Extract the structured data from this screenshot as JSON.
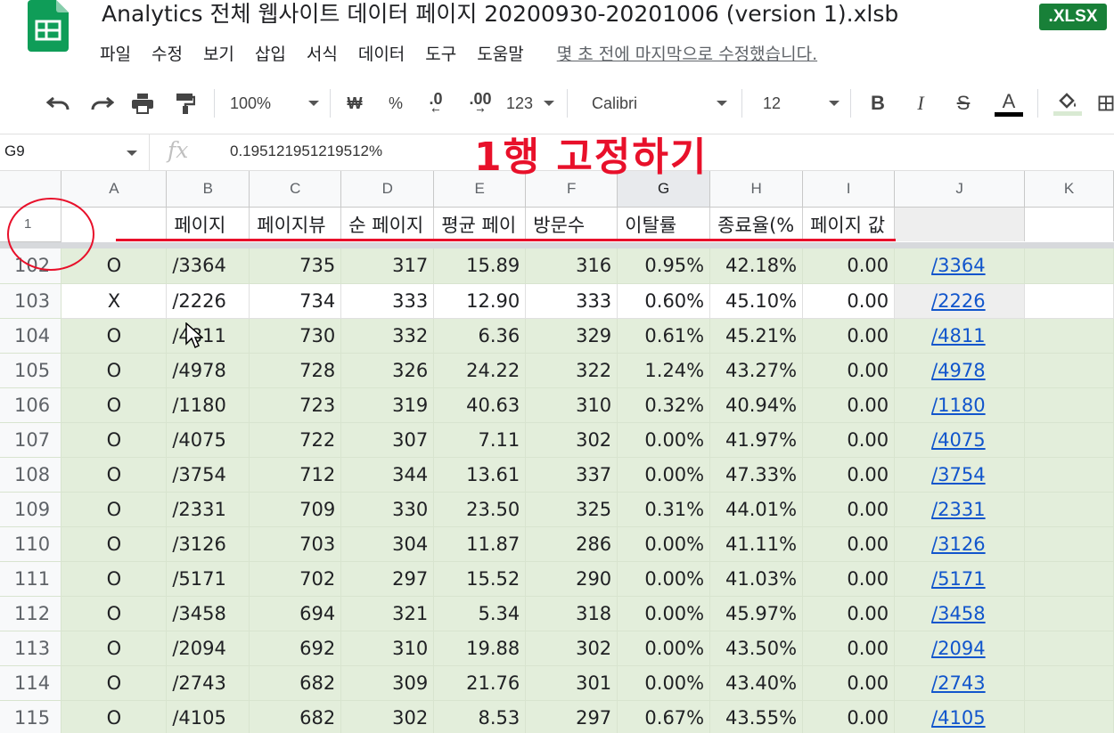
{
  "app": {
    "doc_title": "Analytics 전체 웹사이트 데이터 페이지 20200930-20201006 (version 1).xlsb",
    "file_badge": ".XLSX",
    "last_edit": "몇 초 전에 마지막으로 수정했습니다.",
    "menu": [
      "파일",
      "수정",
      "보기",
      "삽입",
      "서식",
      "데이터",
      "도구",
      "도움말"
    ],
    "brand_color": "#0f9d58",
    "badge_color": "#188038"
  },
  "toolbar": {
    "zoom": "100%",
    "currency": "₩",
    "percent": "%",
    "decrease_decimal": ".0",
    "increase_decimal": ".00",
    "number_format": "123",
    "font": "Calibri",
    "font_size": "12",
    "icons": [
      "undo-icon",
      "redo-icon",
      "print-icon",
      "paint-format-icon",
      "bold-icon",
      "italic-icon",
      "strikethrough-icon",
      "text-color-icon",
      "fill-color-icon"
    ]
  },
  "formula_bar": {
    "name_box": "G9",
    "fx": "fx",
    "value": "0.195121951219512%"
  },
  "annotation": {
    "text": "1행 고정하기",
    "color": "#e8102a"
  },
  "grid": {
    "columns": [
      "A",
      "B",
      "C",
      "D",
      "E",
      "F",
      "G",
      "H",
      "I",
      "J",
      "K"
    ],
    "selected_column": "G",
    "header_row_number": "1",
    "header_row": [
      "",
      "페이지",
      "페이지뷰",
      "순 페이지",
      "평균 페이",
      "방문수",
      "이탈률",
      "종료율(%",
      "페이지 값",
      "",
      ""
    ],
    "rows": [
      {
        "num": "102",
        "a": "O",
        "b": "/3364",
        "c": "735",
        "d": "317",
        "e": "15.89",
        "f": "316",
        "g": "0.95%",
        "h": "42.18%",
        "i": "0.00",
        "j": "/3364",
        "k": ""
      },
      {
        "num": "103",
        "a": "X",
        "b": "/2226",
        "c": "734",
        "d": "333",
        "e": "12.90",
        "f": "333",
        "g": "0.60%",
        "h": "45.10%",
        "i": "0.00",
        "j": "/2226",
        "k": ""
      },
      {
        "num": "104",
        "a": "O",
        "b": "/4811",
        "c": "730",
        "d": "332",
        "e": "6.36",
        "f": "329",
        "g": "0.61%",
        "h": "45.21%",
        "i": "0.00",
        "j": "/4811",
        "k": ""
      },
      {
        "num": "105",
        "a": "O",
        "b": "/4978",
        "c": "728",
        "d": "326",
        "e": "24.22",
        "f": "322",
        "g": "1.24%",
        "h": "43.27%",
        "i": "0.00",
        "j": "/4978",
        "k": ""
      },
      {
        "num": "106",
        "a": "O",
        "b": "/1180",
        "c": "723",
        "d": "319",
        "e": "40.63",
        "f": "310",
        "g": "0.32%",
        "h": "40.94%",
        "i": "0.00",
        "j": "/1180",
        "k": ""
      },
      {
        "num": "107",
        "a": "O",
        "b": "/4075",
        "c": "722",
        "d": "307",
        "e": "7.11",
        "f": "302",
        "g": "0.00%",
        "h": "41.97%",
        "i": "0.00",
        "j": "/4075",
        "k": ""
      },
      {
        "num": "108",
        "a": "O",
        "b": "/3754",
        "c": "712",
        "d": "344",
        "e": "13.61",
        "f": "337",
        "g": "0.00%",
        "h": "47.33%",
        "i": "0.00",
        "j": "/3754",
        "k": ""
      },
      {
        "num": "109",
        "a": "O",
        "b": "/2331",
        "c": "709",
        "d": "330",
        "e": "23.50",
        "f": "325",
        "g": "0.31%",
        "h": "44.01%",
        "i": "0.00",
        "j": "/2331",
        "k": ""
      },
      {
        "num": "110",
        "a": "O",
        "b": "/3126",
        "c": "703",
        "d": "304",
        "e": "11.87",
        "f": "286",
        "g": "0.00%",
        "h": "41.11%",
        "i": "0.00",
        "j": "/3126",
        "k": ""
      },
      {
        "num": "111",
        "a": "O",
        "b": "/5171",
        "c": "702",
        "d": "297",
        "e": "15.52",
        "f": "290",
        "g": "0.00%",
        "h": "41.03%",
        "i": "0.00",
        "j": "/5171",
        "k": ""
      },
      {
        "num": "112",
        "a": "O",
        "b": "/3458",
        "c": "694",
        "d": "321",
        "e": "5.34",
        "f": "318",
        "g": "0.00%",
        "h": "45.97%",
        "i": "0.00",
        "j": "/3458",
        "k": ""
      },
      {
        "num": "113",
        "a": "O",
        "b": "/2094",
        "c": "692",
        "d": "310",
        "e": "19.88",
        "f": "302",
        "g": "0.00%",
        "h": "43.50%",
        "i": "0.00",
        "j": "/2094",
        "k": ""
      },
      {
        "num": "114",
        "a": "O",
        "b": "/2743",
        "c": "682",
        "d": "309",
        "e": "21.76",
        "f": "301",
        "g": "0.00%",
        "h": "43.40%",
        "i": "0.00",
        "j": "/2743",
        "k": ""
      },
      {
        "num": "115",
        "a": "O",
        "b": "/4105",
        "c": "682",
        "d": "302",
        "e": "8.53",
        "f": "297",
        "g": "0.67%",
        "h": "43.55%",
        "i": "0.00",
        "j": "/4105",
        "k": ""
      }
    ],
    "row_colors": {
      "green": "#e3eedb",
      "white": "#ffffff"
    }
  }
}
